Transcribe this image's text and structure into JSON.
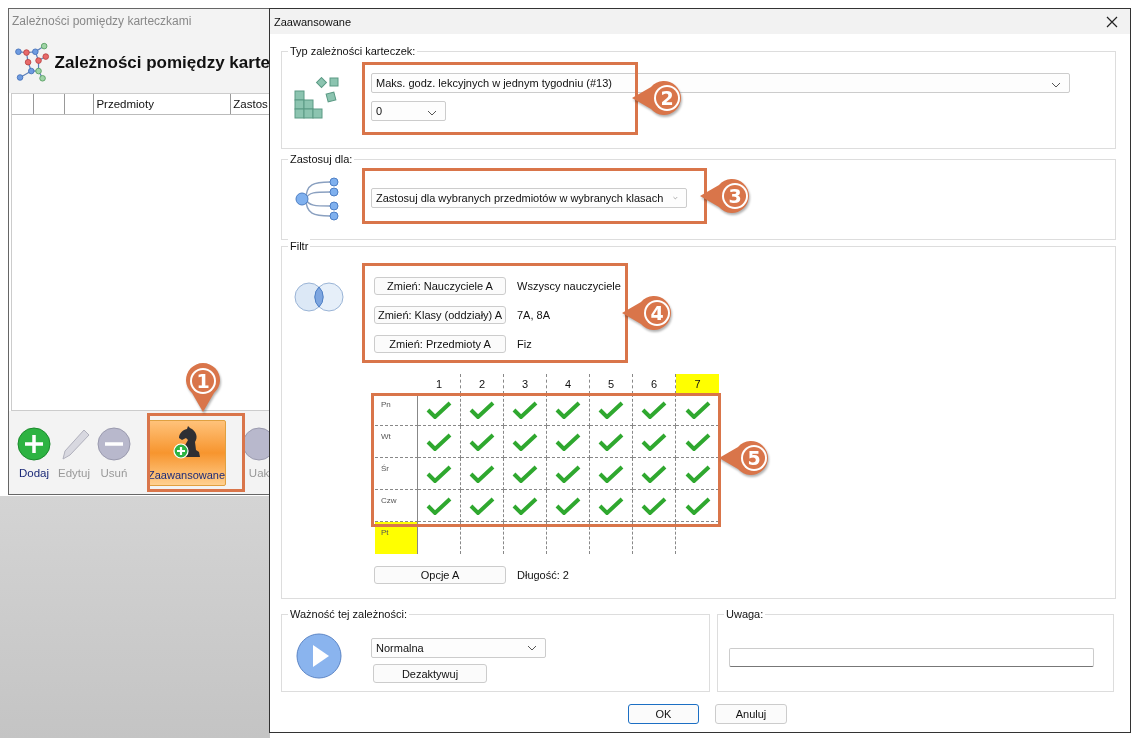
{
  "back_window": {
    "title": "Zależności pomiędzy karteczkami",
    "heading": "Zależności pomiędzy karte",
    "table": {
      "columns": [
        "Przedmioty",
        "Zastos"
      ]
    },
    "toolbar": [
      {
        "label": "Dodaj",
        "kind": "add",
        "disabled": false,
        "selected": false
      },
      {
        "label": "Edytuj",
        "kind": "edit",
        "disabled": true,
        "selected": false
      },
      {
        "label": "Usuń",
        "kind": "remove",
        "disabled": true,
        "selected": false
      },
      {
        "label": "Zaawansowane",
        "kind": "advanced",
        "disabled": false,
        "selected": true
      },
      {
        "label": "Uak",
        "kind": "partial",
        "disabled": true,
        "selected": false
      }
    ]
  },
  "dialog": {
    "title": "Zaawansowane",
    "type_group": {
      "legend": "Typ zależności karteczek:",
      "type_select": "Maks. godz. lekcyjnych w jednym tygodniu (#13)",
      "value_select": "0"
    },
    "apply_group": {
      "legend": "Zastosuj dla:",
      "select": "Zastosuj dla wybranych przedmiotów w wybranych klasach"
    },
    "filter_group": {
      "legend": "Filtr",
      "filters": [
        {
          "button": "Zmień: Nauczyciele A",
          "value": "Wszyscy nauczyciele"
        },
        {
          "button": "Zmień: Klasy (oddziały) A",
          "value": "7A, 8A"
        },
        {
          "button": "Zmień: Przedmioty A",
          "value": "Fiz"
        }
      ],
      "grid": {
        "columns": [
          {
            "label": "1",
            "highlighted": false
          },
          {
            "label": "2",
            "highlighted": false
          },
          {
            "label": "3",
            "highlighted": false
          },
          {
            "label": "4",
            "highlighted": false
          },
          {
            "label": "5",
            "highlighted": false
          },
          {
            "label": "6",
            "highlighted": false
          },
          {
            "label": "7",
            "highlighted": true
          }
        ],
        "rows": [
          {
            "label": "Pn",
            "highlighted": false,
            "cells": [
              true,
              true,
              true,
              true,
              true,
              true,
              true
            ]
          },
          {
            "label": "Wt",
            "highlighted": false,
            "cells": [
              true,
              true,
              true,
              true,
              true,
              true,
              true
            ]
          },
          {
            "label": "Śr",
            "highlighted": false,
            "cells": [
              true,
              true,
              true,
              true,
              true,
              true,
              true
            ]
          },
          {
            "label": "Czw",
            "highlighted": false,
            "cells": [
              true,
              true,
              true,
              true,
              true,
              true,
              true
            ]
          },
          {
            "label": "Pt",
            "highlighted": true,
            "cells": [
              false,
              false,
              false,
              false,
              false,
              false,
              false
            ]
          }
        ]
      },
      "options_button": "Opcje A",
      "length": "Długość: 2"
    },
    "importance_group": {
      "legend": "Ważność tej zależności:",
      "select": "Normalna",
      "button": "Dezaktywuj"
    },
    "note_group": {
      "legend": "Uwaga:"
    },
    "buttons": [
      {
        "label": "OK",
        "default": true
      },
      {
        "label": "Anuluj",
        "default": false
      }
    ]
  },
  "callouts": [
    {
      "number": "1"
    },
    {
      "number": "2"
    },
    {
      "number": "3"
    },
    {
      "number": "4"
    },
    {
      "number": "5"
    }
  ]
}
